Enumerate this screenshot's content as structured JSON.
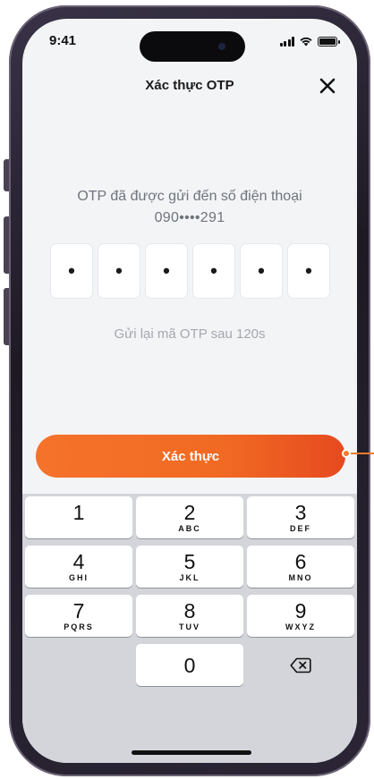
{
  "status_bar": {
    "time": "9:41"
  },
  "header": {
    "title": "Xác thực OTP",
    "close_icon": "close-icon"
  },
  "otp": {
    "message_line1": "OTP đã được gửi đến số điện thoại",
    "phone_masked": "090••••291",
    "digits": [
      "•",
      "•",
      "•",
      "•",
      "•",
      "•"
    ],
    "resend_text": "Gửi lại mã OTP sau 120s"
  },
  "verify_button": {
    "label": "Xác thực",
    "color": "#f16a24"
  },
  "keypad": {
    "keys": [
      {
        "num": "1",
        "letters": ""
      },
      {
        "num": "2",
        "letters": "ABC"
      },
      {
        "num": "3",
        "letters": "DEF"
      },
      {
        "num": "4",
        "letters": "GHI"
      },
      {
        "num": "5",
        "letters": "JKL"
      },
      {
        "num": "6",
        "letters": "MNO"
      },
      {
        "num": "7",
        "letters": "PQRS"
      },
      {
        "num": "8",
        "letters": "TUV"
      },
      {
        "num": "9",
        "letters": "WXYZ"
      },
      {
        "num": "0",
        "letters": ""
      }
    ],
    "delete_icon": "backspace-icon"
  }
}
